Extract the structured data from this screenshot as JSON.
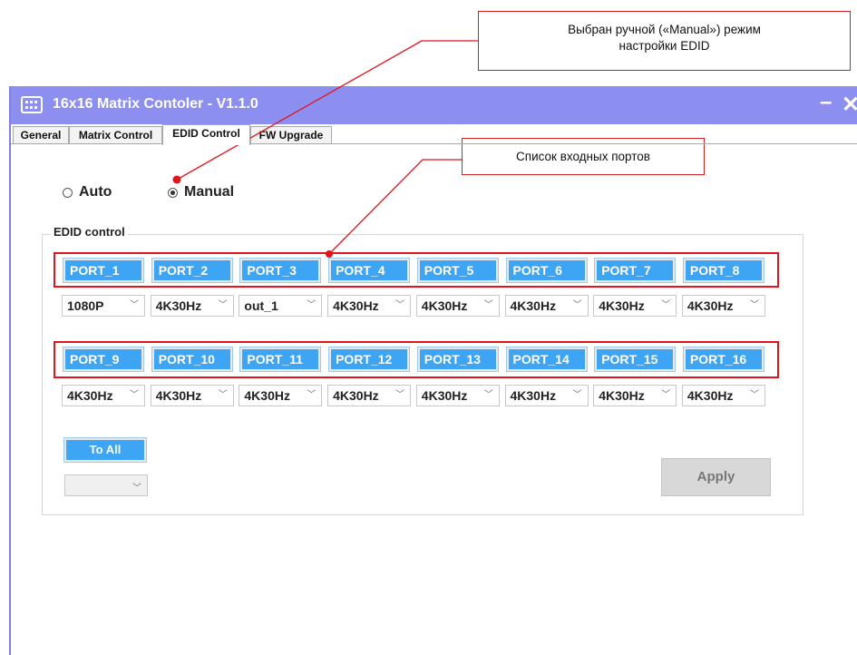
{
  "annotations": {
    "edid_mode_callout": "Выбран ручной («Manual») режим\nнастройки EDID",
    "ports_callout": "Список входных портов"
  },
  "window": {
    "title": "16x16 Matrix Contoler - V1.1.0",
    "minimize": "–",
    "close": "✕",
    "icon": "matrix-grid-icon"
  },
  "tabs": [
    {
      "label": "General"
    },
    {
      "label": "Matrix Control"
    },
    {
      "label": "EDID Control",
      "active": true
    },
    {
      "label": "FW Upgrade"
    }
  ],
  "mode": {
    "auto_label": "Auto",
    "manual_label": "Manual",
    "selected": "Manual"
  },
  "edid": {
    "group_title": "EDID control",
    "ports": [
      {
        "name": "PORT_1",
        "edid": "1080P"
      },
      {
        "name": "PORT_2",
        "edid": "4K30Hz"
      },
      {
        "name": "PORT_3",
        "edid": "out_1"
      },
      {
        "name": "PORT_4",
        "edid": "4K30Hz"
      },
      {
        "name": "PORT_5",
        "edid": "4K30Hz"
      },
      {
        "name": "PORT_6",
        "edid": "4K30Hz"
      },
      {
        "name": "PORT_7",
        "edid": "4K30Hz"
      },
      {
        "name": "PORT_8",
        "edid": "4K30Hz"
      },
      {
        "name": "PORT_9",
        "edid": "4K30Hz"
      },
      {
        "name": "PORT_10",
        "edid": "4K30Hz"
      },
      {
        "name": "PORT_11",
        "edid": "4K30Hz"
      },
      {
        "name": "PORT_12",
        "edid": "4K30Hz"
      },
      {
        "name": "PORT_13",
        "edid": "4K30Hz"
      },
      {
        "name": "PORT_14",
        "edid": "4K30Hz"
      },
      {
        "name": "PORT_15",
        "edid": "4K30Hz"
      },
      {
        "name": "PORT_16",
        "edid": "4K30Hz"
      }
    ],
    "to_all_label": "To All",
    "to_all_value": "",
    "apply_label": "Apply"
  },
  "colors": {
    "titlebar": "#8d8ff0",
    "port_button": "#3da5f4",
    "annotation_red": "#e0141c"
  }
}
